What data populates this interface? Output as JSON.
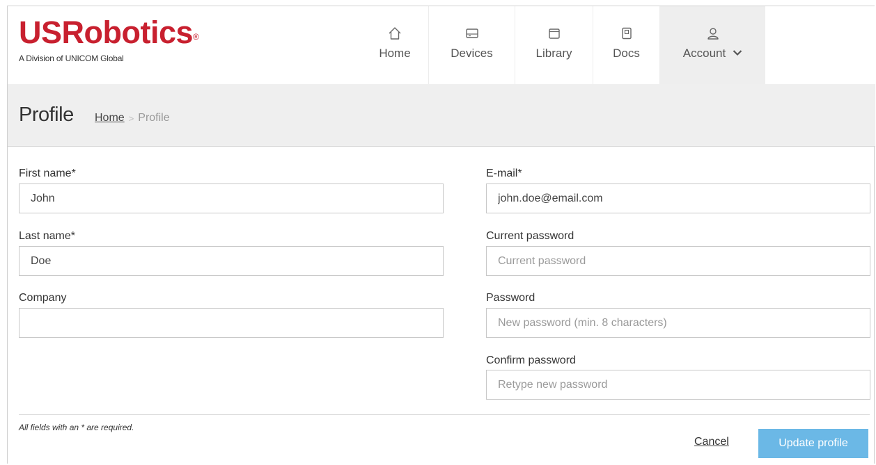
{
  "brand": {
    "name": "USRobotics",
    "trademark": "®",
    "tagline": "A Division of UNICOM Global",
    "color": "#c8202f"
  },
  "nav": {
    "items": [
      {
        "label": "Home",
        "icon": "home-icon"
      },
      {
        "label": "Devices",
        "icon": "devices-icon"
      },
      {
        "label": "Library",
        "icon": "library-icon"
      },
      {
        "label": "Docs",
        "icon": "docs-icon"
      },
      {
        "label": "Account",
        "icon": "user-icon",
        "active": true
      }
    ]
  },
  "page": {
    "title": "Profile",
    "breadcrumb": {
      "home": "Home",
      "separator": ">",
      "current": "Profile"
    }
  },
  "form": {
    "first_name": {
      "label": "First name*",
      "value": "John"
    },
    "last_name": {
      "label": "Last name*",
      "value": "Doe"
    },
    "company": {
      "label": "Company",
      "value": ""
    },
    "email": {
      "label": "E-mail*",
      "value": "john.doe@email.com"
    },
    "current_password": {
      "label": "Current password",
      "placeholder": "Current password"
    },
    "password": {
      "label": "Password",
      "placeholder": "New password (min. 8 characters)"
    },
    "confirm_password": {
      "label": "Confirm password",
      "placeholder": "Retype new password"
    },
    "required_note": "All fields with an * are required.",
    "cancel_label": "Cancel",
    "submit_label": "Update profile"
  },
  "colors": {
    "accent": "#6bb8e6",
    "titlebar_bg": "#efefef"
  }
}
